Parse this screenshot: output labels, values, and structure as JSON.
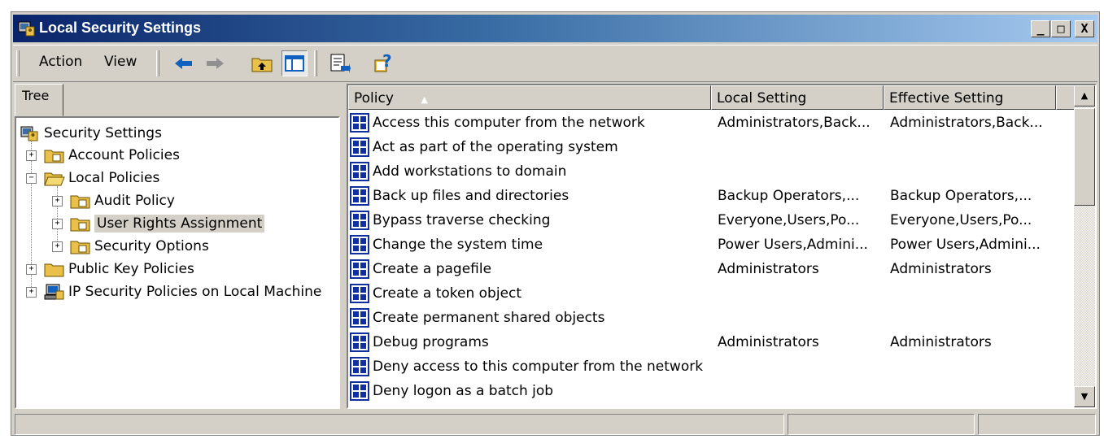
{
  "window": {
    "title": "Local Security Settings"
  },
  "caption_buttons": {
    "minimize": "_",
    "maximize": "□",
    "close": "X"
  },
  "menu": {
    "action": "Action",
    "view": "View"
  },
  "toolbar_icons": [
    "back-arrow-icon",
    "forward-arrow-icon",
    "up-one-level-icon",
    "show-hide-tree-icon",
    "export-list-icon",
    "help-icon"
  ],
  "tree": {
    "tab_label": "Tree",
    "nodes": [
      {
        "label": "Security Settings",
        "icon": "security-settings-icon"
      },
      {
        "label": "Account Policies",
        "icon": "folder-icon"
      },
      {
        "label": "Local Policies",
        "icon": "folder-open-icon"
      },
      {
        "label": "Audit Policy",
        "icon": "folder-icon"
      },
      {
        "label": "User Rights Assignment",
        "icon": "folder-icon",
        "selected": true
      },
      {
        "label": "Security Options",
        "icon": "folder-icon"
      },
      {
        "label": "Public Key Policies",
        "icon": "folder-icon"
      },
      {
        "label": "IP Security Policies on Local Machine",
        "icon": "computer-icon"
      }
    ]
  },
  "list": {
    "columns": {
      "policy": "Policy",
      "local": "Local Setting",
      "effective": "Effective Setting"
    },
    "sort_indicator": "▲",
    "rows": [
      {
        "policy": "Access this computer from the network",
        "local": "Administrators,Back...",
        "effective": "Administrators,Back..."
      },
      {
        "policy": "Act as part of the operating system",
        "local": "",
        "effective": ""
      },
      {
        "policy": "Add workstations to domain",
        "local": "",
        "effective": ""
      },
      {
        "policy": "Back up files and directories",
        "local": "Backup Operators,...",
        "effective": "Backup Operators,..."
      },
      {
        "policy": "Bypass traverse checking",
        "local": "Everyone,Users,Po...",
        "effective": "Everyone,Users,Po..."
      },
      {
        "policy": "Change the system time",
        "local": "Power Users,Admini...",
        "effective": "Power Users,Admini..."
      },
      {
        "policy": "Create a pagefile",
        "local": "Administrators",
        "effective": "Administrators"
      },
      {
        "policy": "Create a token object",
        "local": "",
        "effective": ""
      },
      {
        "policy": "Create permanent shared objects",
        "local": "",
        "effective": ""
      },
      {
        "policy": "Debug programs",
        "local": "Administrators",
        "effective": "Administrators"
      },
      {
        "policy": "Deny access to this computer from the network",
        "local": "",
        "effective": ""
      },
      {
        "policy": "Deny logon as a batch job",
        "local": "",
        "effective": ""
      }
    ]
  },
  "scrollbar": {
    "up": "▲",
    "down": "▼"
  }
}
